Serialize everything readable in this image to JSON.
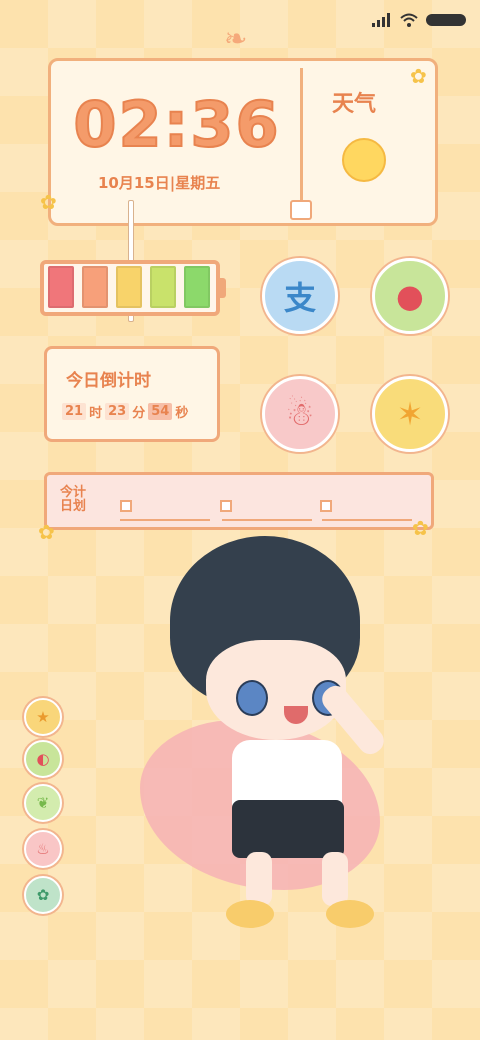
{
  "status_bar": {
    "signal_icon": "signal-bars-icon",
    "wifi_icon": "wifi-icon",
    "battery_icon": "battery-icon"
  },
  "clock_widget": {
    "time": "02:36",
    "date": "10月15日|星期五"
  },
  "weather_widget": {
    "title": "天气",
    "icon": "sun-icon"
  },
  "battery_widget": {
    "cells": [
      {
        "color": "#f0767a"
      },
      {
        "color": "#f7a07a"
      },
      {
        "color": "#f8d36a"
      },
      {
        "color": "#c9e26b"
      },
      {
        "color": "#8cd96b"
      }
    ]
  },
  "apps": [
    {
      "name": "alipay",
      "glyph": "支",
      "bg": "#b9daf3",
      "fg": "#3b87c9"
    },
    {
      "name": "watermelon",
      "glyph": "●",
      "bg": "#c8e59a",
      "fg": "#e2505a"
    },
    {
      "name": "snowman",
      "glyph": "☃",
      "bg": "#f8c9c9",
      "fg": "#e26a6a"
    },
    {
      "name": "star-fruit",
      "glyph": "✶",
      "bg": "#f9dc7a",
      "fg": "#f1a532"
    }
  ],
  "countdown": {
    "title": "今日倒计时",
    "hours": "21",
    "hour_unit": "时",
    "minutes": "23",
    "minute_unit": "分",
    "seconds": "54",
    "second_unit": "秒"
  },
  "plan_widget": {
    "title": "今计日划"
  },
  "dock": [
    {
      "name": "dock-star",
      "glyph": "★",
      "bg": "#f9d67a",
      "fg": "#ea9a2e"
    },
    {
      "name": "dock-watermelon",
      "glyph": "◐",
      "bg": "#c8e59a",
      "fg": "#e2505a"
    },
    {
      "name": "dock-leaf",
      "glyph": "❦",
      "bg": "#d3ecae",
      "fg": "#76b94b"
    },
    {
      "name": "dock-cake",
      "glyph": "♨",
      "bg": "#f9c6c6",
      "fg": "#e26a6a"
    },
    {
      "name": "dock-frog",
      "glyph": "✿",
      "bg": "#bfe3c9",
      "fg": "#3e9a6a"
    }
  ]
}
